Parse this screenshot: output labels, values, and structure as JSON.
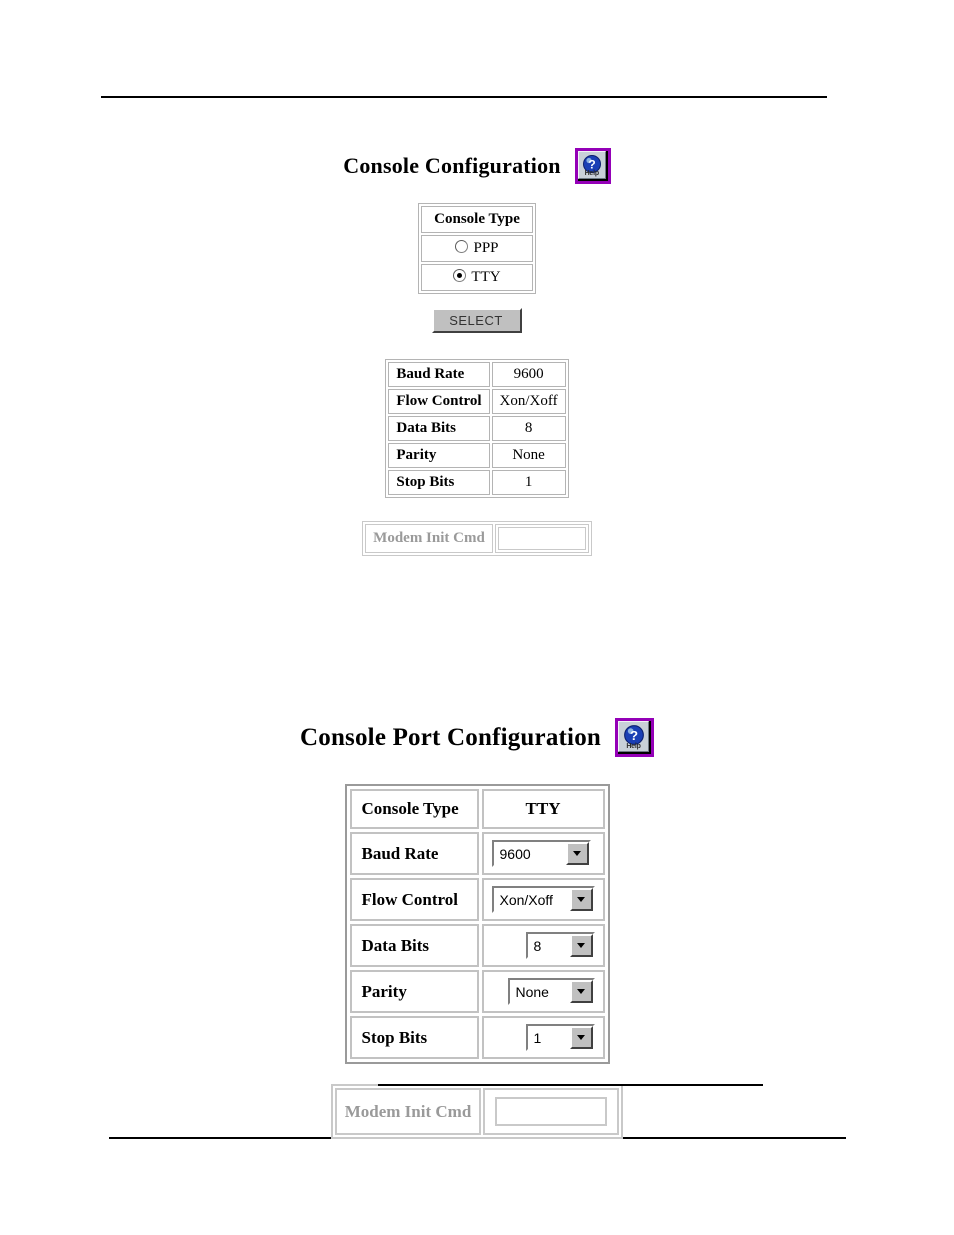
{
  "page": {
    "rules": {
      "top": "horizontal-rule",
      "bottom": "horizontal-rule",
      "section_divider": "horizontal-rule"
    }
  },
  "section_console": {
    "title": "Console Configuration",
    "help_button": {
      "icon": "help-question-icon",
      "label": "Help"
    },
    "console_type_table": {
      "header": "Console Type",
      "options": [
        {
          "label": "PPP",
          "selected": false
        },
        {
          "label": "TTY",
          "selected": true
        }
      ]
    },
    "select_button_label": "SELECT",
    "settings_table": {
      "rows": [
        {
          "label": "Baud Rate",
          "value": "9600"
        },
        {
          "label": "Flow Control",
          "value": "Xon/Xoff"
        },
        {
          "label": "Data Bits",
          "value": "8"
        },
        {
          "label": "Parity",
          "value": "None"
        },
        {
          "label": "Stop Bits",
          "value": "1"
        }
      ]
    },
    "modem_row": {
      "label": "Modem Init Cmd",
      "value": "",
      "placeholder": ""
    }
  },
  "section_console_port": {
    "title": "Console Port Configuration",
    "help_button": {
      "icon": "help-question-icon",
      "label": "Help"
    },
    "settings_table": {
      "console_type": {
        "label": "Console Type",
        "value": "TTY"
      },
      "rows": [
        {
          "label": "Baud Rate",
          "value": "9600",
          "control": "dropdown"
        },
        {
          "label": "Flow Control",
          "value": "Xon/Xoff",
          "control": "dropdown"
        },
        {
          "label": "Data Bits",
          "value": "8",
          "control": "dropdown"
        },
        {
          "label": "Parity",
          "value": "None",
          "control": "dropdown"
        },
        {
          "label": "Stop Bits",
          "value": "1",
          "control": "dropdown"
        }
      ]
    },
    "modem_row": {
      "label": "Modem Init Cmd",
      "value": "",
      "placeholder": ""
    }
  }
}
